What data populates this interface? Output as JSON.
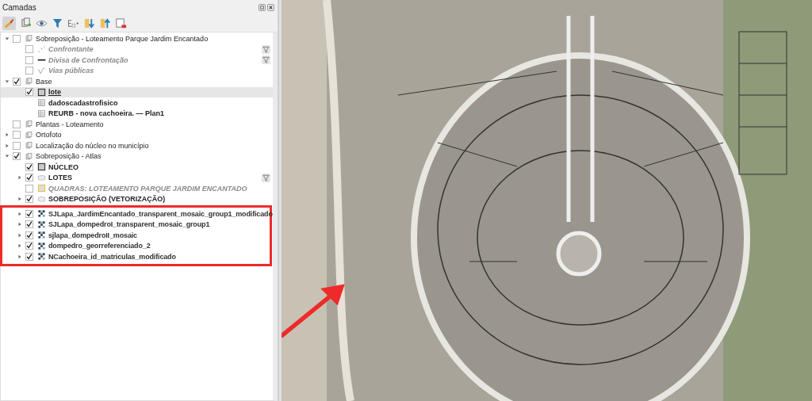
{
  "panel": {
    "title": "Camadas"
  },
  "layers": [
    {
      "label": "Sobreposição - Loteamento Parque Jardim Encantado",
      "kind": "group",
      "expanded": true,
      "checked": false,
      "selected": false,
      "disabled": false,
      "children": [
        {
          "label": "Confrontante",
          "kind": "point",
          "checked": false,
          "selected": false,
          "disabled": true,
          "filtered": true
        },
        {
          "label": "Divisa de Confrontação",
          "kind": "line",
          "checked": false,
          "selected": false,
          "disabled": true,
          "filtered": true
        },
        {
          "label": "Vias públicas",
          "kind": "vias",
          "checked": false,
          "selected": false,
          "disabled": true
        }
      ]
    },
    {
      "label": "Base",
      "kind": "group",
      "expanded": true,
      "checked": true,
      "selected": false,
      "disabled": false,
      "children": [
        {
          "label": "lote",
          "kind": "polygon",
          "checked": true,
          "selected": true,
          "disabled": false
        },
        {
          "label": "dadoscadastrofisico",
          "kind": "table",
          "selected": false,
          "disabled": false
        },
        {
          "label": "REURB - nova cachoeira. — Plan1",
          "kind": "table",
          "selected": false,
          "disabled": false
        }
      ]
    },
    {
      "label": "Plantas - Loteamento",
      "kind": "group",
      "checked": false,
      "selected": false,
      "disabled": false
    },
    {
      "label": "Ortofoto",
      "kind": "group",
      "expanded": false,
      "checked": false,
      "selected": false,
      "disabled": false
    },
    {
      "label": "Localização do núcleo no município",
      "kind": "group",
      "expanded": false,
      "checked": false,
      "selected": false,
      "disabled": false
    },
    {
      "label": "Sobreposição - Atlas",
      "kind": "group",
      "expanded": true,
      "checked": true,
      "selected": false,
      "disabled": false,
      "children": [
        {
          "label": "NÚCLEO",
          "kind": "polygon",
          "checked": true,
          "selected": false,
          "disabled": false
        },
        {
          "label": "LOTES",
          "kind": "rules",
          "expanded": false,
          "checked": true,
          "selected": false,
          "disabled": false,
          "filtered": true
        },
        {
          "label": "QUADRAS: LOTEAMENTO PARQUE JARDIM ENCANTADO",
          "kind": "polygon-outline",
          "checked": false,
          "selected": false,
          "disabled": true
        },
        {
          "label": "SOBREPOSIÇÃO (VETORIZAÇÃO)",
          "kind": "rules",
          "expanded": false,
          "checked": true,
          "selected": false,
          "disabled": false
        }
      ],
      "highlighted_children": [
        {
          "label": "SJLapa_JardimEncantado_transparent_mosaic_group1_modificado",
          "kind": "raster",
          "expanded": false,
          "checked": true,
          "selected": false,
          "disabled": false
        },
        {
          "label": "SJLapa_dompedroI_transparent_mosaic_group1",
          "kind": "raster",
          "expanded": false,
          "checked": true,
          "selected": false,
          "disabled": false
        },
        {
          "label": "sjlapa_dompedroII_mosaic",
          "kind": "raster",
          "expanded": false,
          "checked": true,
          "selected": false,
          "disabled": false
        },
        {
          "label": "dompedro_georreferenciado_2",
          "kind": "raster",
          "expanded": false,
          "checked": true,
          "selected": false,
          "disabled": false
        },
        {
          "label": "NCachoeira_id_matriculas_modificado",
          "kind": "raster",
          "expanded": false,
          "checked": true,
          "selected": false,
          "disabled": false
        }
      ]
    }
  ]
}
